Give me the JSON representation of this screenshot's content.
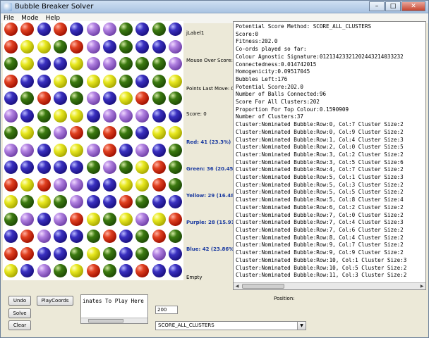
{
  "window": {
    "title": "Bubble Breaker Solver"
  },
  "menu": [
    "File",
    "Mode",
    "Help"
  ],
  "board": {
    "cols": 11,
    "rows": 15,
    "grid": [
      "rrbrbppgbgb",
      "ryygrpbgbbp",
      "gybbyppgggp",
      "rbbygyygbgy",
      "bgrbgpbyrgg",
      "pbgyybpppbb",
      "gygprgrgbyy",
      "ppbyyprbpbg",
      "bbbbbgpgyrg",
      "ryrppbbyyrg",
      "ygygpbbrgbb",
      "gpbprygypyr",
      "brpbbgrbgrg",
      "rrbbgygbgpb",
      "ybpgyrgbrbb"
    ]
  },
  "info": {
    "label1": "jLabel1",
    "mouse_over": "Mouse Over Score:",
    "points_last_move": "Points Last Move: 0 (0)",
    "score": "Score: 0",
    "red": "Red: 41 (23.3%)",
    "green": "Green: 36 (20.45%)",
    "yellow": "Yellow: 29 (16.48%)",
    "purple": "Purple: 28 (15.91%)",
    "blue": "Blue: 42 (23.86%)",
    "empty": "Empty"
  },
  "log": {
    "lines": [
      "Potential Score Method: SCORE_ALL_CLUSTERS",
      "Score:0",
      "Fitness:202.0",
      "Co-ords played so far:",
      "Colour Agnostic Signature:01213423321202443214033232",
      "Connectedness:0.014742015",
      "Homogenicity:0.09517045",
      "Bubbles Left:176",
      "Potential Score:202.0",
      "Number of Balls Connected:96",
      "Score For All Clusters:202",
      "Proportion For Top Colour:0.1590909",
      "Number of Clusters:37",
      "Cluster:Nominated Bubble:Row:0, Col:7 Cluster Size:2",
      "Cluster:Nominated Bubble:Row:0, Col:9 Cluster Size:2",
      "Cluster:Nominated Bubble:Row:1, Col:4 Cluster Size:3",
      "Cluster:Nominated Bubble:Row:2, Col:0 Cluster Size:5",
      "Cluster:Nominated Bubble:Row:3, Col:2 Cluster Size:2",
      "Cluster:Nominated Bubble:Row:3, Col:5 Cluster Size:6",
      "Cluster:Nominated Bubble:Row:4, Col:7 Cluster Size:2",
      "Cluster:Nominated Bubble:Row:5, Col:1 Cluster Size:3",
      "Cluster:Nominated Bubble:Row:5, Col:3 Cluster Size:2",
      "Cluster:Nominated Bubble:Row:5, Col:5 Cluster Size:2",
      "Cluster:Nominated Bubble:Row:5, Col:8 Cluster Size:4",
      "Cluster:Nominated Bubble:Row:6, Col:2 Cluster Size:2",
      "Cluster:Nominated Bubble:Row:7, Col:0 Cluster Size:2",
      "Cluster:Nominated Bubble:Row:7, Col:4 Cluster Size:3",
      "Cluster:Nominated Bubble:Row:7, Col:6 Cluster Size:2",
      "Cluster:Nominated Bubble:Row:8, Col:4 Cluster Size:2",
      "Cluster:Nominated Bubble:Row:9, Col:7 Cluster Size:2",
      "Cluster:Nominated Bubble:Row:9, Col:9 Cluster Size:2",
      "Cluster:Nominated Bubble:Row:10, Col:1 Cluster Size:3",
      "Cluster:Nominated Bubble:Row:10, Col:5 Cluster Size:2",
      "Cluster:Nominated Bubble:Row:11, Col:3 Cluster Size:2"
    ]
  },
  "controls": {
    "undo": "Undo",
    "playcoords": "PlayCoords",
    "solve": "Solve",
    "clear": "Clear",
    "coords_text": "inates To Play Here",
    "position_label": "Position:",
    "number_value": "200",
    "method_selected": "SCORE_ALL_CLUSTERS"
  },
  "colors": {
    "r": "red",
    "b": "blue",
    "g": "green",
    "y": "yellow",
    "p": "purple"
  }
}
